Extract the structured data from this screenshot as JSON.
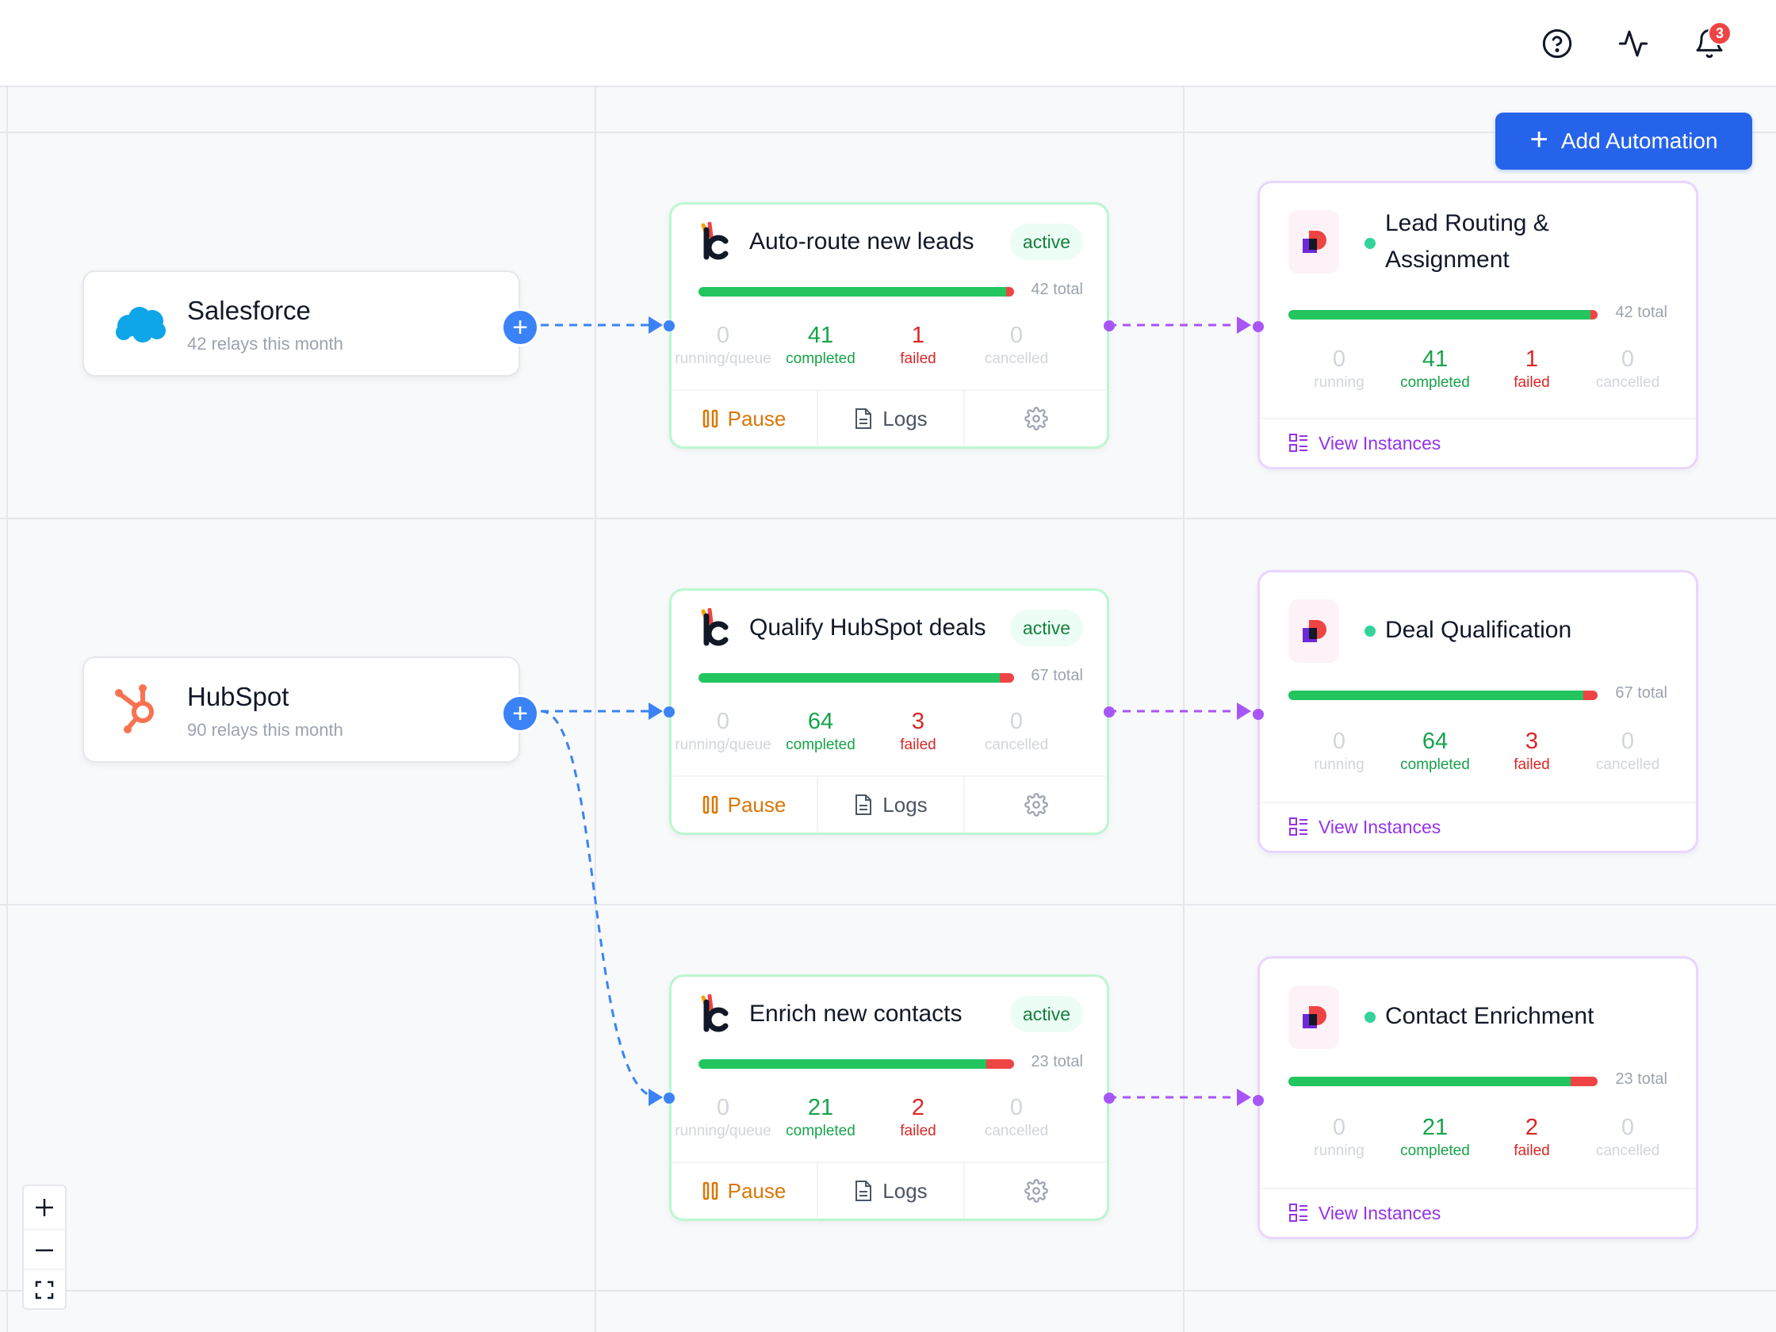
{
  "header": {
    "notifications_count": "3",
    "icons": [
      "help-circle-icon",
      "activity-icon",
      "bell-icon"
    ]
  },
  "toolbar": {
    "add_automation_label": "Add Automation"
  },
  "colors": {
    "primary": "#2563eb",
    "success": "#22c55e",
    "danger": "#ef4444",
    "pause": "#d97706",
    "workflow": "#9333ea",
    "edge_source": "#3b82f6",
    "edge_target": "#a855f7"
  },
  "sources": [
    {
      "name": "Salesforce",
      "subtitle": "42 relays this month",
      "icon": "salesforce-cloud-icon"
    },
    {
      "name": "HubSpot",
      "subtitle": "90 relays this month",
      "icon": "hubspot-icon"
    }
  ],
  "automations": [
    {
      "title": "Auto-route new leads",
      "status": "active",
      "total_label": "42 total",
      "progress_fraction": 0.976,
      "stats": [
        {
          "value": "0",
          "label": "running/queue"
        },
        {
          "value": "41",
          "label": "completed"
        },
        {
          "value": "1",
          "label": "failed"
        },
        {
          "value": "0",
          "label": "cancelled"
        }
      ],
      "actions": {
        "pause": "Pause",
        "logs": "Logs"
      }
    },
    {
      "title": "Qualify HubSpot deals",
      "status": "active",
      "total_label": "67 total",
      "progress_fraction": 0.955,
      "stats": [
        {
          "value": "0",
          "label": "running/queue"
        },
        {
          "value": "64",
          "label": "completed"
        },
        {
          "value": "3",
          "label": "failed"
        },
        {
          "value": "0",
          "label": "cancelled"
        }
      ],
      "actions": {
        "pause": "Pause",
        "logs": "Logs"
      }
    },
    {
      "title": "Enrich new contacts",
      "status": "active",
      "total_label": "23 total",
      "progress_fraction": 0.913,
      "stats": [
        {
          "value": "0",
          "label": "running/queue"
        },
        {
          "value": "21",
          "label": "completed"
        },
        {
          "value": "2",
          "label": "failed"
        },
        {
          "value": "0",
          "label": "cancelled"
        }
      ],
      "actions": {
        "pause": "Pause",
        "logs": "Logs"
      }
    }
  ],
  "workflows": [
    {
      "title": "Lead Routing & Assignment",
      "total_label": "42 total",
      "progress_fraction": 0.976,
      "stats": [
        {
          "value": "0",
          "label": "running"
        },
        {
          "value": "41",
          "label": "completed"
        },
        {
          "value": "1",
          "label": "failed"
        },
        {
          "value": "0",
          "label": "cancelled"
        }
      ],
      "view_label": "View Instances"
    },
    {
      "title": "Deal Qualification",
      "total_label": "67 total",
      "progress_fraction": 0.955,
      "stats": [
        {
          "value": "0",
          "label": "running"
        },
        {
          "value": "64",
          "label": "completed"
        },
        {
          "value": "3",
          "label": "failed"
        },
        {
          "value": "0",
          "label": "cancelled"
        }
      ],
      "view_label": "View Instances"
    },
    {
      "title": "Contact Enrichment",
      "total_label": "23 total",
      "progress_fraction": 0.913,
      "stats": [
        {
          "value": "0",
          "label": "running"
        },
        {
          "value": "21",
          "label": "completed"
        },
        {
          "value": "2",
          "label": "failed"
        },
        {
          "value": "0",
          "label": "cancelled"
        }
      ],
      "view_label": "View Instances"
    }
  ],
  "zoom_controls": {
    "zoom_in": "+",
    "zoom_out": "–"
  }
}
